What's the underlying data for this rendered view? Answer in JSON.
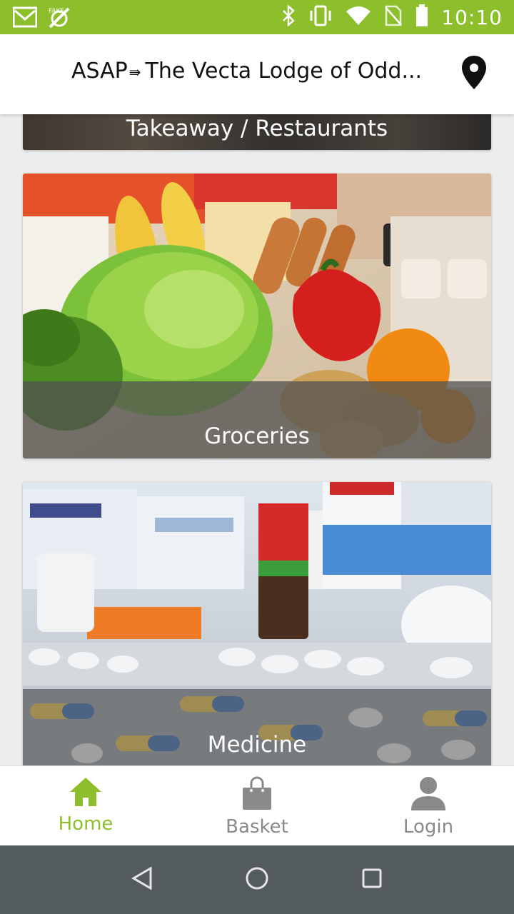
{
  "status_bar": {
    "time": "10:10",
    "icons": [
      "gmail-icon",
      "fake-gps-icon",
      "bluetooth-icon",
      "vibrate-icon",
      "wifi-icon",
      "no-sim-icon",
      "battery-icon"
    ]
  },
  "header": {
    "title": "ASAP",
    "arrow": "⇛",
    "location": "The Vecta Lodge of Odd...",
    "icon": "location-pin-icon"
  },
  "categories": [
    {
      "label": "Takeaway / Restaurants"
    },
    {
      "label": "Groceries"
    },
    {
      "label": "Medicine"
    }
  ],
  "bottom_nav": {
    "items": [
      {
        "label": "Home",
        "icon": "home-icon",
        "active": true
      },
      {
        "label": "Basket",
        "icon": "basket-icon",
        "active": false
      },
      {
        "label": "Login",
        "icon": "person-icon",
        "active": false
      }
    ],
    "active_color": "#8cbf2b",
    "inactive_color": "#8a8a8a"
  },
  "android_nav": [
    "back-icon",
    "home-circle-icon",
    "recents-icon"
  ]
}
